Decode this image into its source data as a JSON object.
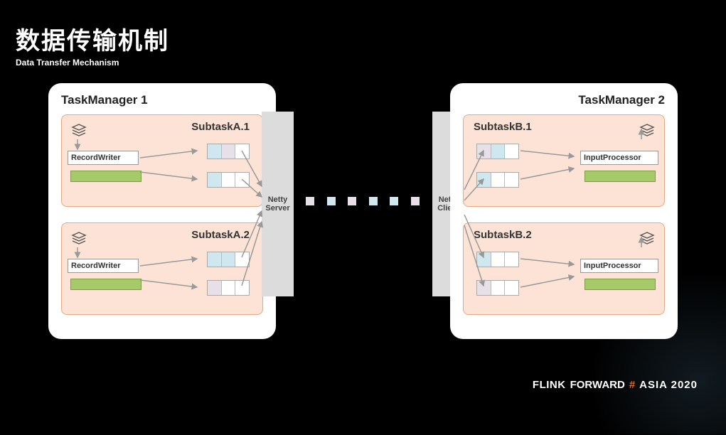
{
  "title": {
    "main": "数据传输机制",
    "sub": "Data Transfer Mechanism"
  },
  "tm1": {
    "label": "TaskManager 1",
    "subtasks": [
      {
        "name": "SubtaskA.1",
        "component": "RecordWriter"
      },
      {
        "name": "SubtaskA.2",
        "component": "RecordWriter"
      }
    ]
  },
  "tm2": {
    "label": "TaskManager 2",
    "subtasks": [
      {
        "name": "SubtaskB.1",
        "component": "InputProcessor"
      },
      {
        "name": "SubtaskB.2",
        "component": "InputProcessor"
      }
    ]
  },
  "netty": {
    "server": "Netty Server",
    "client": "Netty Client"
  },
  "footer": {
    "flink": "FLINK",
    "forward": "FORWARD",
    "hash": "#",
    "asia": "ASIA 2020"
  }
}
